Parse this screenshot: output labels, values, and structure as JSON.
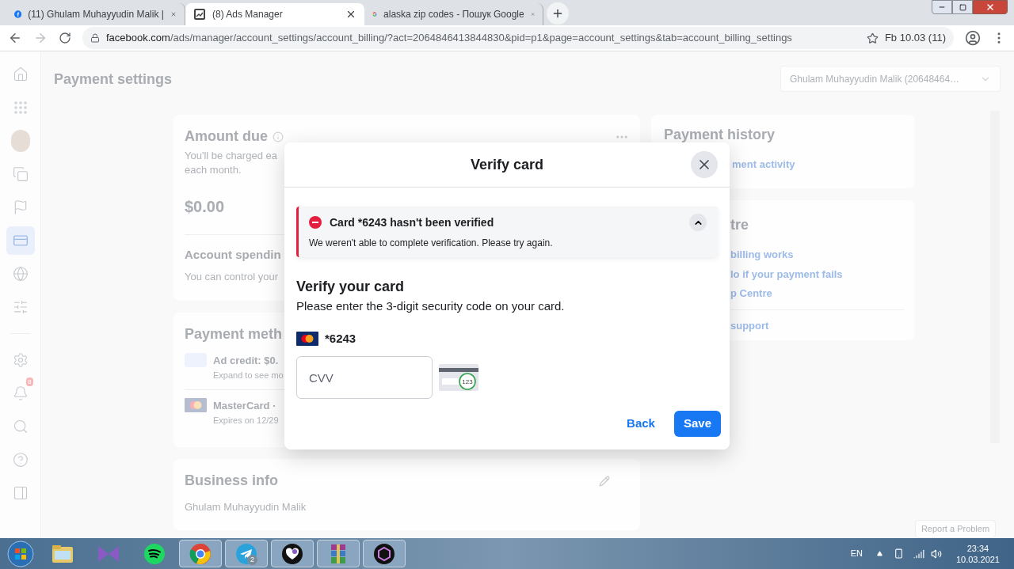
{
  "browser": {
    "tabs": [
      {
        "title": "(11) Ghulam Muhayyudin Malik |",
        "kind": "facebook",
        "selected": false
      },
      {
        "title": "(8) Ads Manager",
        "kind": "ads",
        "selected": true
      },
      {
        "title": "alaska zip codes - Пошук Google",
        "kind": "google",
        "selected": false
      }
    ],
    "url_host": "facebook.com",
    "url_path": "/ads/manager/account_settings/account_billing/?act=2064846413844830&pid=p1&page=account_settings&tab=account_billing_settings",
    "profile": "Fb 10.03 (11)"
  },
  "sidebar": {
    "items": [
      {
        "kind": "home",
        "selected": false
      },
      {
        "kind": "apps",
        "selected": false
      },
      {
        "kind": "avatar",
        "selected": false
      },
      {
        "kind": "pages",
        "selected": false
      },
      {
        "kind": "flag",
        "selected": false
      },
      {
        "kind": "billing",
        "selected": true
      },
      {
        "kind": "globe",
        "selected": false
      },
      {
        "kind": "tune",
        "selected": false
      }
    ],
    "bottom_items": [
      {
        "kind": "settings",
        "selected": false
      },
      {
        "kind": "bell",
        "selected": false,
        "badge": "8"
      },
      {
        "kind": "search",
        "selected": false
      },
      {
        "kind": "help",
        "selected": false
      },
      {
        "kind": "panel",
        "selected": false
      }
    ]
  },
  "page": {
    "title": "Payment settings",
    "account": "Ghulam Muhayyudin Malik (20648464…"
  },
  "amount_due": {
    "title": "Amount due",
    "text_1": "You'll be charged ea",
    "text_2": "each month.",
    "amount": "$0.00",
    "spending_title": "Account spendin",
    "spending_text": "You can control your"
  },
  "payment_methods": {
    "title": "Payment meth",
    "rows": [
      {
        "kind": "credit",
        "title": "Ad credit: $0.",
        "sub": "Expand to see mo"
      },
      {
        "kind": "card",
        "title": "MasterCard ·",
        "sub": "Expires on 12/29"
      }
    ]
  },
  "business_info": {
    "title": "Business info",
    "name": "Ghulam Muhayyudin Malik"
  },
  "payment_history": {
    "title": "Payment history",
    "link": "ment activity"
  },
  "billing_help": {
    "title": "tre",
    "links": [
      "billing works",
      "lo if your payment fails",
      "p Centre"
    ],
    "support": "support"
  },
  "report_button": "Report a Problem",
  "dialog": {
    "title": "Verify card",
    "alert": {
      "title": "Card *6243 hasn't been verified",
      "body": "We weren't able to complete verification. Please try again.",
      "expanded": true
    },
    "heading": "Verify your card",
    "description": "Please enter the 3-digit security code on your card.",
    "card_number": "*6243",
    "cvv_placeholder": "CVV",
    "cvv_hint": "123",
    "back": "Back",
    "save": "Save"
  },
  "taskbar": {
    "items": [
      {
        "kind": "folder",
        "open": false
      },
      {
        "kind": "bowtie",
        "open": false
      },
      {
        "kind": "music",
        "open": false
      },
      {
        "kind": "browser",
        "open": true
      },
      {
        "kind": "plane",
        "open": true,
        "badge": "2"
      },
      {
        "kind": "heart",
        "open": true
      },
      {
        "kind": "archive",
        "open": true
      },
      {
        "kind": "hexagon",
        "open": true
      }
    ],
    "language": "EN",
    "time": "23:34",
    "date": "10.03.2021"
  }
}
